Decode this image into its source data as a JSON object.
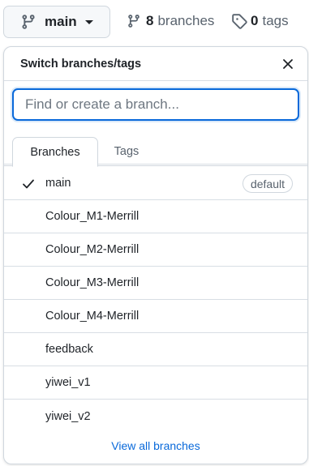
{
  "topbar": {
    "current_branch": "main",
    "branches_count": "8",
    "branches_label": "branches",
    "tags_count": "0",
    "tags_label": "tags"
  },
  "panel": {
    "title": "Switch branches/tags",
    "search_placeholder": "Find or create a branch...",
    "tabs": [
      {
        "label": "Branches",
        "active": true
      },
      {
        "label": "Tags",
        "active": false
      }
    ],
    "branches": [
      {
        "name": "main",
        "selected": true,
        "badge": "default"
      },
      {
        "name": "Colour_M1-Merrill"
      },
      {
        "name": "Colour_M2-Merrill"
      },
      {
        "name": "Colour_M3-Merrill"
      },
      {
        "name": "Colour_M4-Merrill"
      },
      {
        "name": "feedback"
      },
      {
        "name": "yiwei_v1"
      },
      {
        "name": "yiwei_v2"
      }
    ],
    "footer_link": "View all branches"
  },
  "colors": {
    "accent": "#0969da",
    "border": "#d0d7de",
    "text": "#1f2328",
    "muted": "#59636e"
  }
}
